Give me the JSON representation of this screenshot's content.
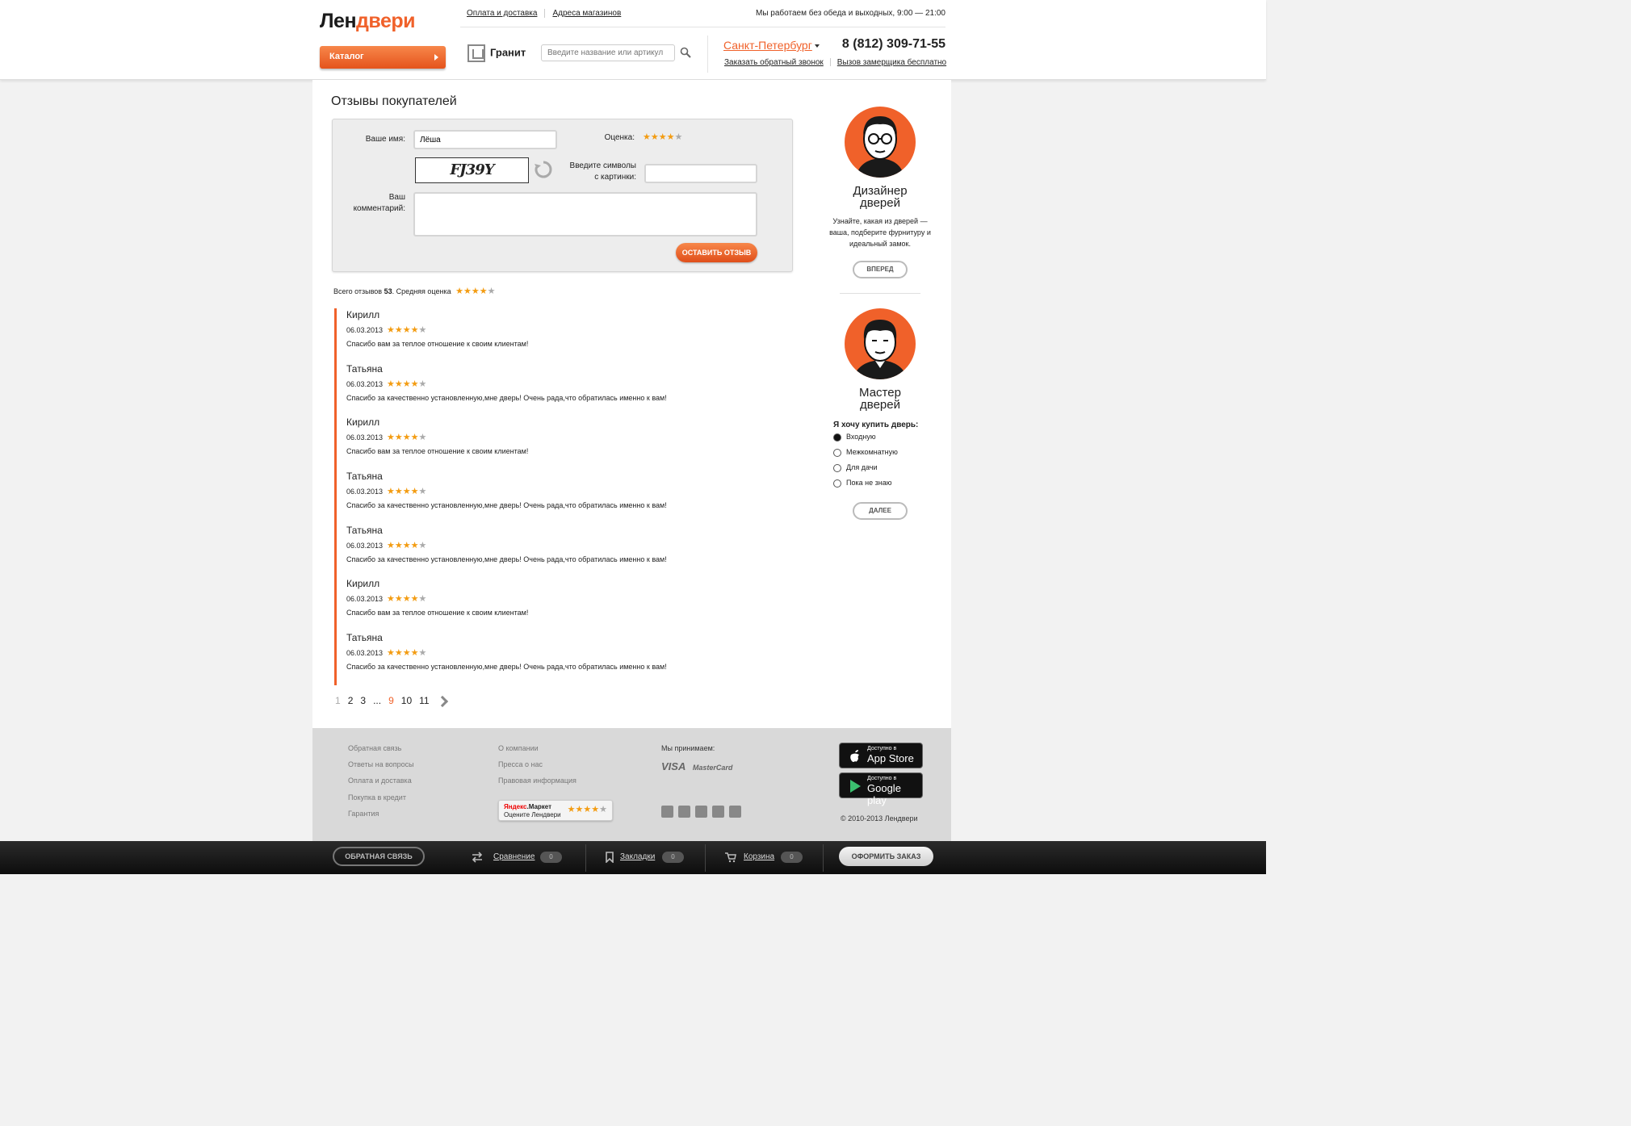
{
  "header": {
    "logo_part1": "Лен",
    "logo_part2": "двери",
    "catalog_label": "Каталог",
    "links": [
      "Оплата и доставка",
      "Адреса магазинов"
    ],
    "work_hours": "Мы работаем без обеда и выходных, 9:00 — 21:00",
    "brand_name": "Гранит",
    "search_placeholder": "Введите название или артикул",
    "city": "Санкт-Петербург",
    "phone": "8 (812) 309-71-55",
    "callback_link": "Заказать обратный звонок",
    "measure_link": "Вызов замерщика бесплатно"
  },
  "main": {
    "title": "Отзывы покупателей",
    "form": {
      "name_label": "Ваше имя:",
      "name_value": "Лёша",
      "rating_label": "Оценка:",
      "rating_value": 4,
      "captcha_text": "FJ39Y",
      "captcha_label_line1": "Введите символы",
      "captcha_label_line2": "с картинки:",
      "comment_label_line1": "Ваш",
      "comment_label_line2": "комментарий:",
      "submit_label": "ОСТАВИТЬ ОТЗЫВ"
    },
    "summary": {
      "prefix": "Всего отзывов",
      "count": "53",
      "suffix": ". Средняя оценка",
      "avg_rating": 4
    },
    "reviews": [
      {
        "name": "Кирилл",
        "date": "06.03.2013",
        "rating": 4,
        "text": "Спасибо вам за теплое отношение к своим клиентам!"
      },
      {
        "name": "Татьяна",
        "date": "06.03.2013",
        "rating": 4,
        "text": "Спасибо за качественно установленную,мне дверь! Очень рада,что обратилась именно к вам!"
      },
      {
        "name": "Кирилл",
        "date": "06.03.2013",
        "rating": 4,
        "text": "Спасибо вам за теплое отношение к своим клиентам!"
      },
      {
        "name": "Татьяна",
        "date": "06.03.2013",
        "rating": 4,
        "text": "Спасибо за качественно установленную,мне дверь! Очень рада,что обратилась именно к вам!"
      },
      {
        "name": "Татьяна",
        "date": "06.03.2013",
        "rating": 4,
        "text": "Спасибо за качественно установленную,мне дверь! Очень рада,что обратилась именно к вам!"
      },
      {
        "name": "Кирилл",
        "date": "06.03.2013",
        "rating": 4,
        "text": "Спасибо вам за теплое отношение к своим клиентам!"
      },
      {
        "name": "Татьяна",
        "date": "06.03.2013",
        "rating": 4,
        "text": "Спасибо за качественно установленную,мне дверь! Очень рада,что обратилась именно к вам!"
      }
    ],
    "pager": {
      "pages": [
        "1",
        "2",
        "3",
        "...",
        "9",
        "10",
        "11"
      ],
      "current": "9",
      "disabled": "1"
    }
  },
  "sidebar": {
    "designer_title_line1": "Дизайнер",
    "designer_title_line2": "дверей",
    "designer_desc": "Узнайте, какая из дверей — ваша, подберите фурнитуру и идеальный замок.",
    "designer_btn": "ВПЕРЕД",
    "master_title_line1": "Мастер",
    "master_title_line2": "дверей",
    "question": "Я хочу купить дверь:",
    "options": [
      "Входную",
      "Межкомнатную",
      "Для дачи",
      "Пока не знаю"
    ],
    "selected_option": 0,
    "next_btn": "ДАЛЕЕ"
  },
  "footer": {
    "col1": [
      "Обратная связь",
      "Ответы на вопросы",
      "Оплата и доставка",
      "Покупка в кредит",
      "Гарантия"
    ],
    "col2": [
      "О компании",
      "Пресса о нас",
      "Правовая информация"
    ],
    "payment_label": "Мы принимаем:",
    "visa": "VISA",
    "mastercard": "MasterCard",
    "ymarket_ya": "Яндекс",
    "ymarket_market": ".Маркет",
    "ymarket_sub": "Оцените Лендвери",
    "ymarket_rating": 4,
    "appstore_line1": "Доступно в",
    "appstore_line2": "App Store",
    "gplay_line1": "Доступно в",
    "gplay_line2": "Google play",
    "copyright": "© 2010-2013 Лендвери",
    "social_icons": [
      "twitter-icon",
      "google-plus-icon",
      "youtube-icon",
      "vkontakte-icon",
      "facebook-icon"
    ]
  },
  "bottom_bar": {
    "feedback_btn": "ОБРАТНАЯ СВЯЗЬ",
    "compare_label": "Сравнение",
    "compare_count": "0",
    "bookmarks_label": "Закладки",
    "bookmarks_count": "0",
    "cart_label": "Корзина",
    "cart_count": "0",
    "order_btn": "ОФОРМИТЬ ЗАКАЗ"
  },
  "colors": {
    "accent": "#f0612a",
    "star": "#f39c12"
  }
}
